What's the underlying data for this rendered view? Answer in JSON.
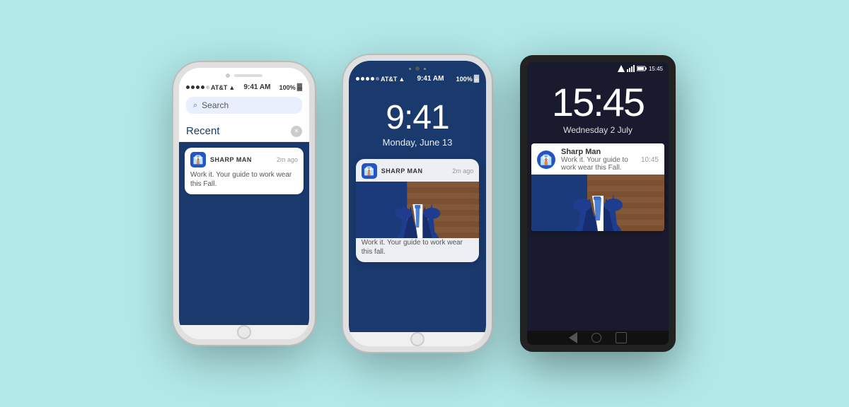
{
  "background_color": "#b2e8e8",
  "phones": {
    "iphone1": {
      "type": "iOS notification center",
      "status_bar": {
        "carrier": "AT&T",
        "wifi": "WiFi",
        "time": "9:41 AM",
        "battery": "100%"
      },
      "search_placeholder": "Search",
      "recent_label": "Recent",
      "notification": {
        "app_name": "SHARP MAN",
        "time": "2m ago",
        "body": "Work it. Your guide to work wear this Fall.",
        "icon": "👔"
      }
    },
    "iphone2": {
      "type": "iOS lock screen",
      "status_bar": {
        "carrier": "AT&T",
        "wifi": "WiFi",
        "time": "9:41 AM",
        "battery": "100%"
      },
      "lock_time": "9:41",
      "lock_date": "Monday, June 13",
      "notification": {
        "app_name": "SHARP MAN",
        "time": "2m ago",
        "body": "Work it. Your guide to work wear this fall.",
        "icon": "👔"
      }
    },
    "android": {
      "type": "Android lock screen",
      "status_bar": {
        "time": "15:45"
      },
      "lock_time": "15:45",
      "lock_date": "Wednesday 2 July",
      "notification": {
        "app_name": "Sharp Man",
        "time": "10:45",
        "body": "Work it. Your guide to work wear this Fall.",
        "icon": "👔"
      }
    }
  }
}
